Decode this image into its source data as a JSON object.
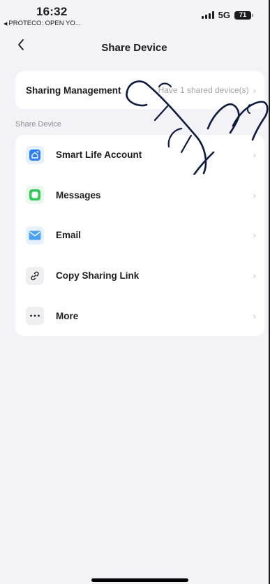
{
  "status_bar": {
    "time": "16:32",
    "back_app": "PROTECO: OPEN YO...",
    "network": "5G",
    "battery": "71"
  },
  "nav": {
    "back_icon": "chevron-left-icon",
    "title": "Share Device"
  },
  "sharing_management": {
    "label": "Sharing Management",
    "value": "Have 1 shared device(s)"
  },
  "section": {
    "label": "Share Device"
  },
  "share_options": [
    {
      "label": "Smart Life Account",
      "icon": "smart-life-icon",
      "color": "#2d7ff9"
    },
    {
      "label": "Messages",
      "icon": "messages-icon",
      "color": "#34c759"
    },
    {
      "label": "Email",
      "icon": "email-icon",
      "color": "#4aa3f5"
    },
    {
      "label": "Copy Sharing Link",
      "icon": "link-icon",
      "color": "#1c1c1e"
    },
    {
      "label": "More",
      "icon": "more-icon",
      "color": "#1c1c1e"
    }
  ]
}
